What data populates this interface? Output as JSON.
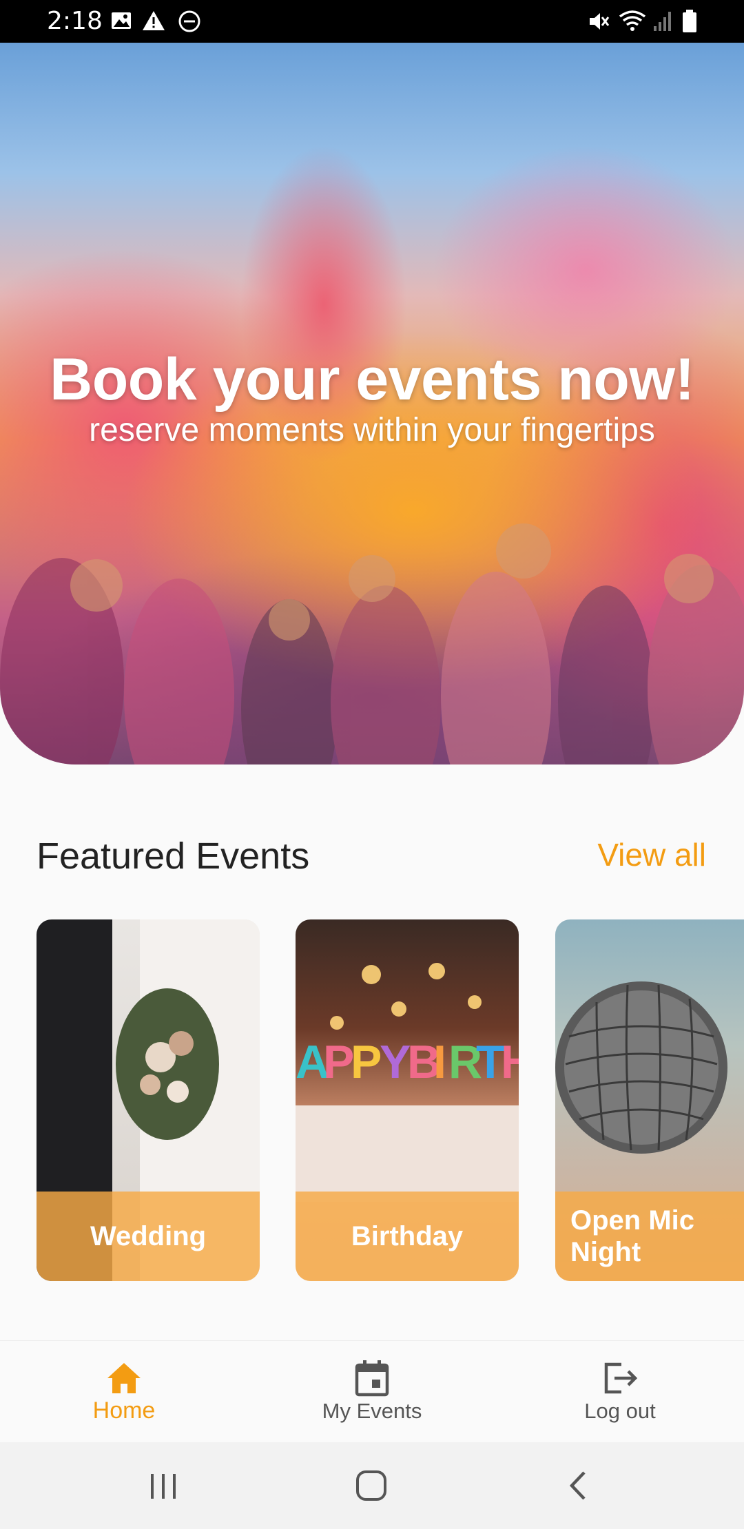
{
  "status_bar": {
    "time": "2:18"
  },
  "hero": {
    "title": "Book your events now!",
    "subtitle": "reserve moments within your fingertips"
  },
  "featured": {
    "title": "Featured Events",
    "view_all": "View all",
    "cards": [
      {
        "label": "Wedding"
      },
      {
        "label": "Birthday"
      },
      {
        "label": "Open Mic Night"
      }
    ]
  },
  "bottom_nav": {
    "items": [
      {
        "label": "Home",
        "icon": "home-icon",
        "active": true
      },
      {
        "label": "My Events",
        "icon": "calendar-icon",
        "active": false
      },
      {
        "label": "Log out",
        "icon": "logout-icon",
        "active": false
      }
    ]
  },
  "colors": {
    "accent": "#f39c12",
    "card_label_bg": "#f6aa46"
  }
}
